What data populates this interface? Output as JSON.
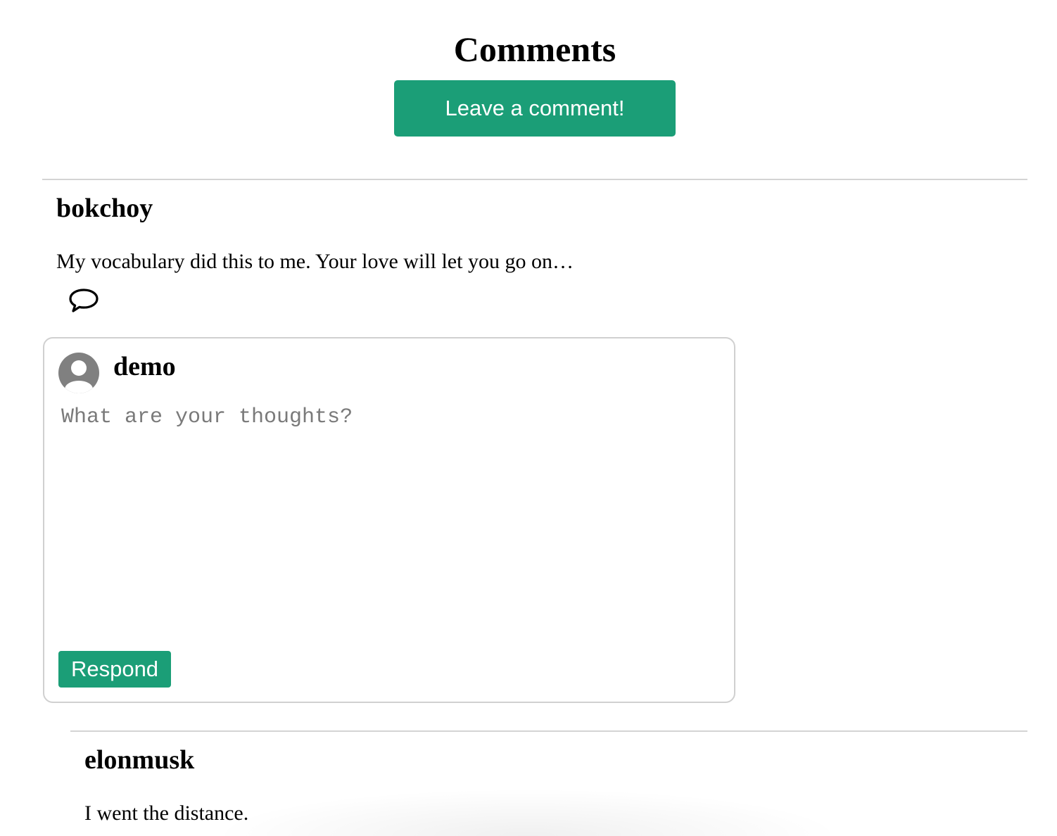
{
  "header": {
    "title": "Comments",
    "leave_comment_label": "Leave a comment!"
  },
  "comments": [
    {
      "author": "bokchoy",
      "body": "My vocabulary did this to me. Your love will let you go on…",
      "reply_icon": "speech-bubble-icon"
    },
    {
      "author": "elonmusk",
      "body": "I went the distance."
    }
  ],
  "reply_form": {
    "user": "demo",
    "avatar_icon": "user-avatar-icon",
    "placeholder": "What are your thoughts?",
    "value": "",
    "submit_label": "Respond"
  },
  "colors": {
    "accent": "#1b9e77",
    "divider": "#d4d4d4",
    "box_border": "#d0d0d0",
    "placeholder": "#7a7a7a",
    "avatar": "#808080"
  }
}
